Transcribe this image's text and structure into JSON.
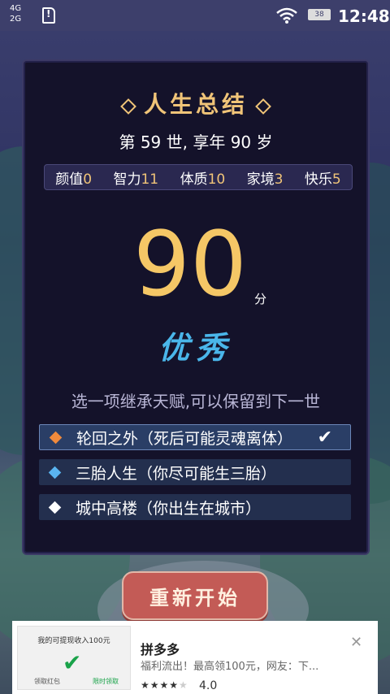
{
  "statusbar": {
    "net_4g": "4G",
    "net_2g": "2G",
    "battery": "38",
    "time": "12:48"
  },
  "panel": {
    "title": "人生总结",
    "life_summary": "第 59 世, 享年 90 岁",
    "stats": [
      {
        "label": "颜值",
        "value": "0"
      },
      {
        "label": "智力",
        "value": "11"
      },
      {
        "label": "体质",
        "value": "10"
      },
      {
        "label": "家境",
        "value": "3"
      },
      {
        "label": "快乐",
        "value": "5"
      }
    ],
    "score": "90",
    "score_unit": "分",
    "grade": "优秀",
    "inherit_tip": "选一项继承天赋,可以保留到下一世",
    "talents": [
      {
        "label": "轮回之外（死后可能灵魂离体）",
        "color": "#f08a3c",
        "selected": true
      },
      {
        "label": "三胎人生（你尽可能生三胎）",
        "color": "#5ab4f0",
        "selected": false
      },
      {
        "label": "城中高楼（你出生在城市）",
        "color": "#ffffff",
        "selected": false
      }
    ],
    "check_mark": "✔"
  },
  "restart_button": "重新开始",
  "ad": {
    "thumb_top": "我的可提现收入100元",
    "thumb_left": "领取红包",
    "thumb_right": "限时领取",
    "title": "拼多多",
    "description": "福利流出！最高领100元，网友：下...",
    "stars": "★★★★",
    "stars_empty": "★",
    "rating": "4.0",
    "close": "✕"
  },
  "colors": {
    "accent_gold": "#f0c478",
    "score": "#f5c766",
    "grade": "#4ab6ea",
    "restart": "#c35b56"
  }
}
